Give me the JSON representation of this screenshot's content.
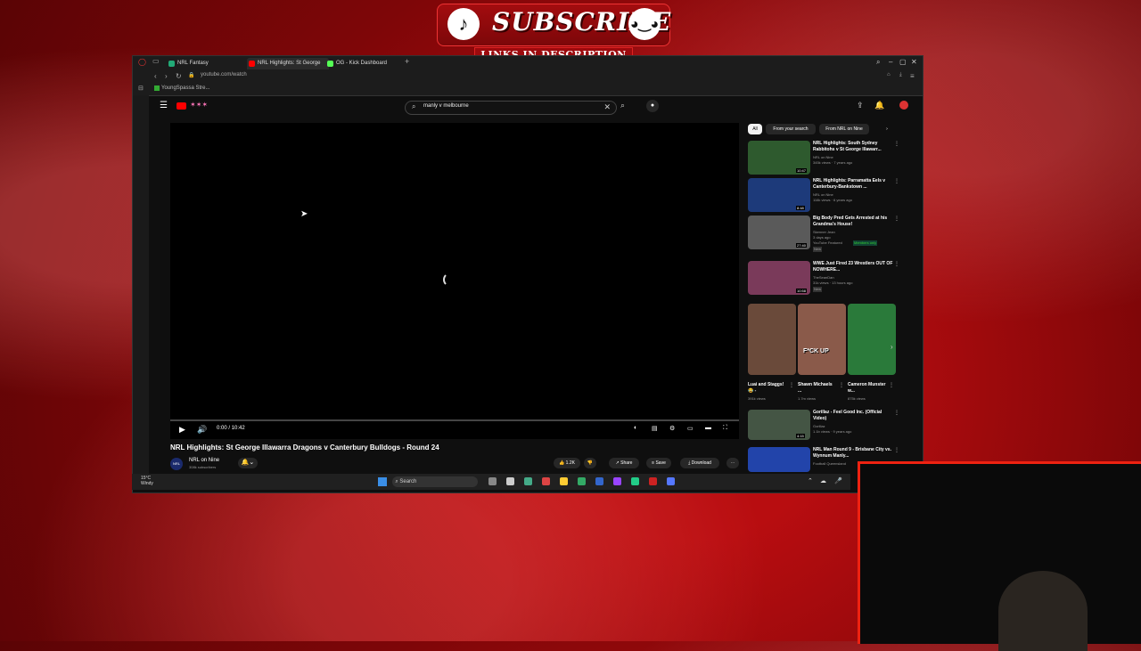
{
  "overlay": {
    "subscribe": "SUBSCRIBE",
    "links": "LINKS IN DESCRIPTION"
  },
  "browser": {
    "tabs": [
      {
        "label": "NRL Fantasy"
      },
      {
        "label": "NRL Highlights: St George"
      },
      {
        "label": "OG - Kick Dashboard"
      }
    ],
    "url": "youtube.com/watch",
    "bookmark": "YoungSpassa Stre..."
  },
  "youtube": {
    "search_value": "manly v melbourne",
    "video_title": "NRL Highlights: St George Illawarra Dragons v Canterbury Bulldogs - Round 24",
    "time": "0:00 / 10:42",
    "channel": "NRL on Nine",
    "subs": "308k subscribers",
    "likes": "1.2K",
    "share": "Share",
    "save": "Save",
    "download": "Download",
    "chips": [
      "All",
      "From your search",
      "From NRL on Nine"
    ],
    "recs": [
      {
        "title": "NRL Highlights: South Sydney Rabbitohs v St George Illawarr...",
        "channel": "NRL on Nine",
        "meta": "345k views · 7 years ago",
        "dur": "10:47",
        "color": "#2e5a2e"
      },
      {
        "title": "NRL Highlights: Parramatta Eels v Canterbury-Bankstown ...",
        "channel": "NRL on Nine",
        "meta": "116k views · 6 years ago",
        "dur": "8:48",
        "color": "#1d3a7a"
      },
      {
        "title": "Big Body Pred Gets Arrested at his Grandma's House!",
        "channel": "Skenner Jean",
        "meta": "3 days ago",
        "dur": "27:40",
        "color": "#5a5a5a"
      },
      {
        "title": "WWE Just Fired 23 Wrestlers OUT OF NOWHERE...",
        "channel": "TheSeanDan",
        "meta": "31k views · 13 hours ago",
        "dur": "10:58",
        "color": "#7a3a5a"
      }
    ],
    "rec_badge_new": "New",
    "rec_featured": "YouTube Featured",
    "rec_members": "Members only",
    "shorts": [
      {
        "title": "Luai and Staggs! 😂 -",
        "views": "391k views",
        "color": "#6a4a3a"
      },
      {
        "title": "Shawn Michaels ...",
        "views": "1.7m views",
        "color": "#8a5a4a"
      },
      {
        "title": "Cameron Munster w...",
        "views": "875k views",
        "color": "#2a7a3a"
      }
    ],
    "short_overlay": "F*CK UP",
    "recs2": [
      {
        "title": "Gorillaz - Feel Good Inc. (Official Video)",
        "channel": "Gorillaz",
        "meta": "1.1b views · 9 years ago",
        "dur": "4:15",
        "color": "#445544"
      },
      {
        "title": "NRL Man Round 9 - Brisbane City vs. Wynnum Manly...",
        "channel": "Football Queensland",
        "meta": "",
        "dur": "",
        "color": "#2244aa"
      }
    ]
  },
  "taskbar": {
    "temp": "15°C",
    "weather": "Windy",
    "search": "Search"
  }
}
